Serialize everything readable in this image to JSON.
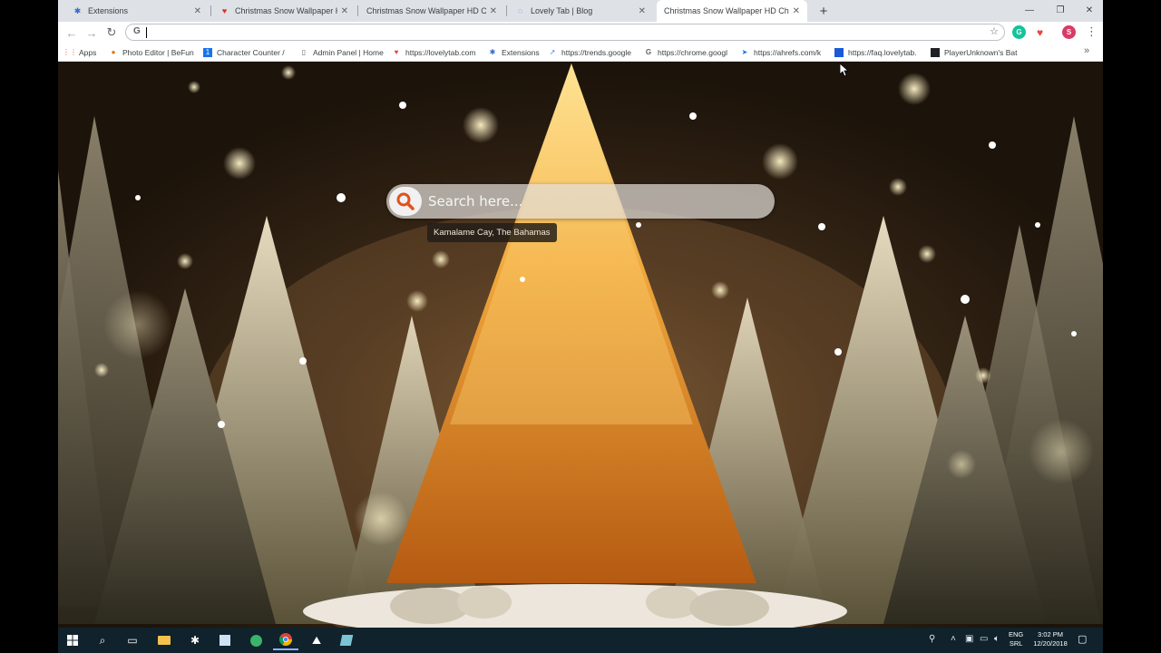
{
  "browser": {
    "tabs": [
      {
        "title": "Extensions",
        "icon": "puzzle-icon",
        "icon_color": "#3367d6",
        "active": false
      },
      {
        "title": "Christmas Snow Wallpaper HD C",
        "icon": "lovely-heart-icon",
        "icon_color": "#d93025",
        "active": false
      },
      {
        "title": "Christmas Snow Wallpaper HD Chrom",
        "icon": "",
        "icon_color": "",
        "active": false
      },
      {
        "title": "Lovely Tab | Blog",
        "icon": "loading-spinner-icon",
        "icon_color": "#1a73e8",
        "active": false
      },
      {
        "title": "Christmas Snow Wallpaper HD Chrom",
        "icon": "",
        "icon_color": "",
        "active": true
      }
    ],
    "omnibox": {
      "value": "",
      "g_label": "G"
    },
    "bookmarks": [
      {
        "label": "Apps",
        "icon": "apps-grid-icon"
      },
      {
        "label": "Photo Editor | BeFun",
        "icon": "befunky-icon"
      },
      {
        "label": "Character Counter / ",
        "icon": "character-counter-icon"
      },
      {
        "label": "Admin Panel | Home",
        "icon": "page-icon"
      },
      {
        "label": "https://lovelytab.com",
        "icon": "lovely-heart-icon"
      },
      {
        "label": "Extensions",
        "icon": "puzzle-icon"
      },
      {
        "label": "https://trends.google",
        "icon": "trends-icon"
      },
      {
        "label": "https://chrome.googl",
        "icon": "google-g-icon"
      },
      {
        "label": "https://ahrefs.com/k",
        "icon": "ahrefs-icon"
      },
      {
        "label": "https://faq.lovelytab.",
        "icon": "faq-square-icon"
      },
      {
        "label": "PlayerUnknown's Bat",
        "icon": "pubg-icon"
      }
    ],
    "extensions": [
      {
        "name": "grammarly-icon",
        "color": "#15c39a",
        "glyph": "G"
      },
      {
        "name": "lovely-heart-icon",
        "color": "#e8453c",
        "glyph": "♥"
      },
      {
        "name": "profile-avatar",
        "color": "#d93a66",
        "glyph": "S"
      }
    ]
  },
  "newtab": {
    "search_placeholder": "Search here...",
    "location": "Kamalame Cay, The Bahamas"
  },
  "taskbar": {
    "lang_top": "ENG",
    "lang_bottom": "SRL",
    "time": "3:02 PM",
    "date": "12/20/2018",
    "accent": "#10222b"
  }
}
